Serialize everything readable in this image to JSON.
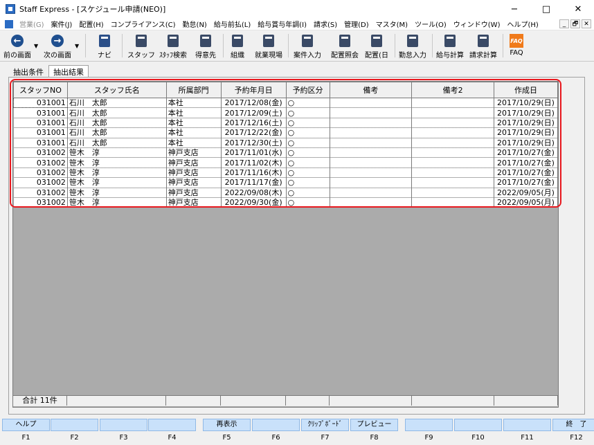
{
  "window": {
    "title": "Staff Express - [スケジュール申請(NEO)]",
    "minimize": "−",
    "maximize": "□",
    "close": "✕"
  },
  "menu": [
    {
      "label": "営業(G)",
      "disabled": true
    },
    {
      "label": "案件(J)"
    },
    {
      "label": "配置(H)"
    },
    {
      "label": "コンプライアンス(C)"
    },
    {
      "label": "勤怠(N)"
    },
    {
      "label": "給与前払(L)"
    },
    {
      "label": "給与賞与年調(I)"
    },
    {
      "label": "請求(S)"
    },
    {
      "label": "管理(D)"
    },
    {
      "label": "マスタ(M)"
    },
    {
      "label": "ツール(O)"
    },
    {
      "label": "ウィンドウ(W)"
    },
    {
      "label": "ヘルプ(H)"
    }
  ],
  "mdi_buttons": [
    "_",
    "🗗",
    "✕"
  ],
  "toolbar": [
    {
      "label": "前の画面",
      "icon": "back-arrow-icon"
    },
    {
      "label": "次の画面",
      "icon": "forward-arrow-icon"
    },
    {
      "label": "ナビ",
      "icon": "navi-icon"
    },
    {
      "label": "スタッフ",
      "icon": "staff-icon"
    },
    {
      "label": "ｽﾀｯﾌ検索",
      "icon": "staff-search-icon"
    },
    {
      "label": "得意先",
      "icon": "customer-icon"
    },
    {
      "label": "組織",
      "icon": "organization-icon"
    },
    {
      "label": "就業現場",
      "icon": "worksite-icon"
    },
    {
      "label": "案件入力",
      "icon": "case-input-icon"
    },
    {
      "label": "配置照会",
      "icon": "assignment-inquiry-icon"
    },
    {
      "label": "配置(日",
      "icon": "assignment-daily-icon"
    },
    {
      "label": "勤怠入力",
      "icon": "attendance-input-icon"
    },
    {
      "label": "給与計算",
      "icon": "payroll-calc-icon"
    },
    {
      "label": "請求計算",
      "icon": "billing-calc-icon"
    },
    {
      "label": "FAQ",
      "icon": "faq-icon"
    }
  ],
  "tabs": [
    "抽出条件",
    "抽出結果"
  ],
  "table": {
    "headers": [
      "スタッフNO",
      "スタッフ氏名",
      "所属部門",
      "予約年月日",
      "予約区分",
      "備考",
      "備考2",
      "作成日"
    ],
    "rows": [
      [
        "031001",
        "石川　太郎",
        "本社",
        "2017/12/08(金)",
        "○",
        "",
        "",
        "2017/10/29(日)"
      ],
      [
        "031001",
        "石川　太郎",
        "本社",
        "2017/12/09(土)",
        "○",
        "",
        "",
        "2017/10/29(日)"
      ],
      [
        "031001",
        "石川　太郎",
        "本社",
        "2017/12/16(土)",
        "○",
        "",
        "",
        "2017/10/29(日)"
      ],
      [
        "031001",
        "石川　太郎",
        "本社",
        "2017/12/22(金)",
        "○",
        "",
        "",
        "2017/10/29(日)"
      ],
      [
        "031001",
        "石川　太郎",
        "本社",
        "2017/12/30(土)",
        "○",
        "",
        "",
        "2017/10/29(日)"
      ],
      [
        "031002",
        "笹木　淳",
        "神戸支店",
        "2017/11/01(水)",
        "○",
        "",
        "",
        "2017/10/27(金)"
      ],
      [
        "031002",
        "笹木　淳",
        "神戸支店",
        "2017/11/02(木)",
        "○",
        "",
        "",
        "2017/10/27(金)"
      ],
      [
        "031002",
        "笹木　淳",
        "神戸支店",
        "2017/11/16(木)",
        "○",
        "",
        "",
        "2017/10/27(金)"
      ],
      [
        "031002",
        "笹木　淳",
        "神戸支店",
        "2017/11/17(金)",
        "○",
        "",
        "",
        "2017/10/27(金)"
      ],
      [
        "031002",
        "笹木　淳",
        "神戸支店",
        "2022/09/08(木)",
        "○",
        "",
        "",
        "2022/09/05(月)"
      ],
      [
        "031002",
        "笹木　淳",
        "神戸支店",
        "2022/09/30(金)",
        "○",
        "",
        "",
        "2022/09/05(月)"
      ]
    ],
    "footer_total": "合計 11件"
  },
  "fkeys": [
    {
      "key": "F1",
      "label": "ヘルプ"
    },
    {
      "key": "F2",
      "label": ""
    },
    {
      "key": "F3",
      "label": ""
    },
    {
      "key": "F4",
      "label": ""
    },
    {
      "key": "F5",
      "label": "再表示"
    },
    {
      "key": "F6",
      "label": ""
    },
    {
      "key": "F7",
      "label": "ｸﾘｯﾌﾟﾎﾞｰﾄﾞ"
    },
    {
      "key": "F8",
      "label": "プレビュー"
    },
    {
      "key": "F9",
      "label": ""
    },
    {
      "key": "F10",
      "label": ""
    },
    {
      "key": "F11",
      "label": ""
    },
    {
      "key": "F12",
      "label": "終　了"
    }
  ],
  "colors": {
    "highlight": "#e8181e",
    "fkey_bg": "#c9e1fa",
    "grid_bg": "#ababab"
  }
}
